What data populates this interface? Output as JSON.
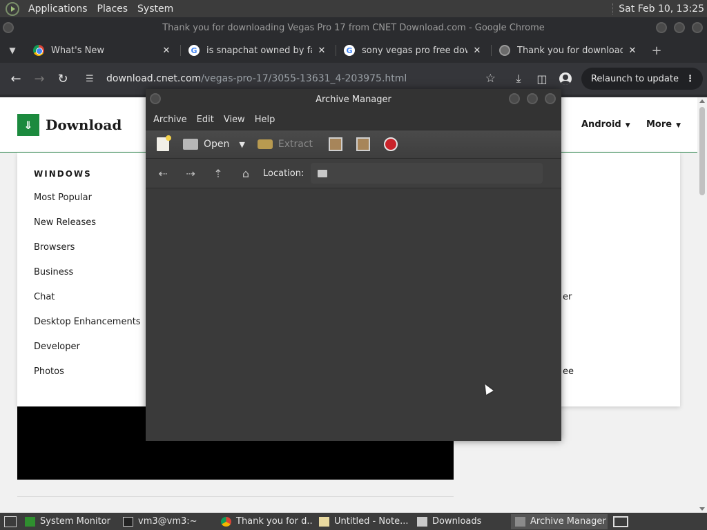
{
  "top_panel": {
    "menus": [
      "Applications",
      "Places",
      "System"
    ],
    "clock": "Sat Feb 10, 13:25"
  },
  "chrome": {
    "window_title": "Thank you for downloading Vegas Pro 17 from CNET Download.com - Google Chrome",
    "tabs": [
      {
        "title": "What's New",
        "favicon": "chrome-icon"
      },
      {
        "title": "is snapchat owned by faceb",
        "favicon": "google-icon"
      },
      {
        "title": "sony vegas pro free downlo",
        "favicon": "google-icon"
      },
      {
        "title": "Thank you for downloading",
        "favicon": "globe-icon"
      }
    ],
    "url_domain": "download.cnet.com",
    "url_path": "/vegas-pro-17/3055-13631_4-203975.html",
    "relaunch_label": "Relaunch to update"
  },
  "site": {
    "logo_text": "Download",
    "nav": [
      "Android",
      "More"
    ],
    "category_heading": "WINDOWS",
    "categories": [
      "Most Popular",
      "New Releases",
      "Browsers",
      "Business",
      "Chat",
      "Desktop Enhancements",
      "Developer",
      "Photos"
    ],
    "partial_right": [
      "er",
      "ee"
    ]
  },
  "archive_manager": {
    "title": "Archive Manager",
    "menus": [
      "Archive",
      "Edit",
      "View",
      "Help"
    ],
    "toolbar": {
      "open_label": "Open",
      "extract_label": "Extract"
    },
    "location_label": "Location:"
  },
  "taskbar": {
    "items": [
      "System Monitor",
      "vm3@vm3:~",
      "Thank you for d...",
      "Untitled - Note...",
      "Downloads",
      "Archive Manager"
    ]
  }
}
